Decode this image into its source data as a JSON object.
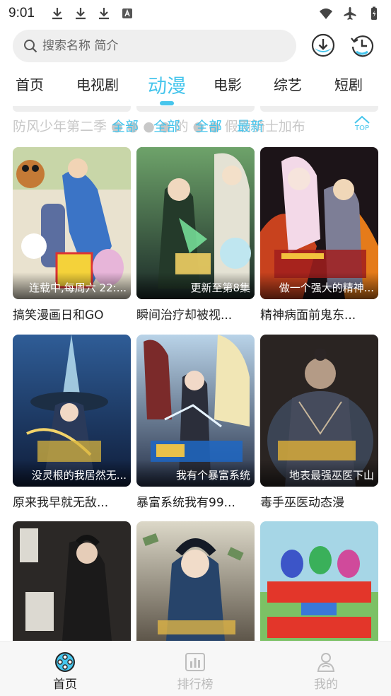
{
  "status": {
    "time": "9:01"
  },
  "search": {
    "placeholder": "搜索名称 简介"
  },
  "header": {
    "download_icon": "download-icon",
    "history_icon": "history-icon"
  },
  "tabs": [
    {
      "label": "首页"
    },
    {
      "label": "电视剧"
    },
    {
      "label": "动漫",
      "active": true
    },
    {
      "label": "电影"
    },
    {
      "label": "综艺"
    },
    {
      "label": "短剧"
    }
  ],
  "filter_strip": {
    "scrolled_text": "防风少年第二季 ● ● ● ● 的 ● ● 假面骑士加布",
    "chips": [
      "全部",
      "全部",
      "全部",
      "最新"
    ],
    "top_label": "TOP"
  },
  "cards": [
    {
      "title": "搞笑漫画日和GO",
      "caption": "连载中,每周六 22:..."
    },
    {
      "title": "瞬间治疗却被视...",
      "caption": "更新至第8集"
    },
    {
      "title": "精神病面前鬼东...",
      "caption": "做一个强大的精神..."
    },
    {
      "title": "原来我早就无敌...",
      "caption": "没灵根的我居然无..."
    },
    {
      "title": "暴富系统我有99...",
      "caption": "我有个暴富系统"
    },
    {
      "title": "毒手巫医动态漫",
      "caption": "地表最强巫医下山"
    },
    {
      "title": "",
      "caption": ""
    },
    {
      "title": "",
      "caption": ""
    },
    {
      "title": "",
      "caption": ""
    }
  ],
  "bottom_nav": [
    {
      "label": "首页",
      "icon": "film-reel-icon",
      "active": true
    },
    {
      "label": "排行榜",
      "icon": "bar-chart-icon"
    },
    {
      "label": "我的",
      "icon": "user-icon"
    }
  ],
  "colors": {
    "accent": "#46c5ec",
    "active_nav": "#222222",
    "inactive_nav": "#b9b9b9"
  }
}
